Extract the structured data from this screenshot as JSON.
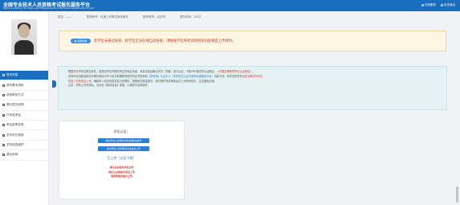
{
  "header": {
    "title": "全国专业技术人员资格考试报名服务平台",
    "subtitle": "Service platform for National Professional and Technical Qualification Exam",
    "links": [
      {
        "icon": "home-icon",
        "label": "在线服务"
      },
      {
        "icon": "user-icon",
        "label": "安全退出"
      }
    ],
    "bg_color": "#1a6ec0"
  },
  "sidebar": {
    "items": [
      {
        "label": "首页导航",
        "active": true,
        "icon": "home-icon"
      },
      {
        "label": "修改基本资料",
        "icon": "edit-icon"
      },
      {
        "label": "修改联系方式",
        "icon": "phone-icon"
      },
      {
        "label": "照片提交说明",
        "icon": "photo-icon"
      },
      {
        "label": "打印准考证",
        "icon": "print-icon"
      },
      {
        "label": "考生报考信息",
        "icon": "info-icon"
      },
      {
        "label": "学历学位核验",
        "icon": "degree-icon"
      },
      {
        "label": "学历信息维护",
        "icon": "database-icon"
      },
      {
        "label": "退出系统",
        "icon": "logout-icon"
      }
    ]
  },
  "infobar": {
    "name": "姓名：——",
    "account": "您的帐号：在读工作单位尚未填写",
    "exam": "报考城市：北京市",
    "date": "发布时间：2022"
  },
  "notice": {
    "badge": "温馨提醒",
    "text": "若学位未通过核查，则学位无法在线自动核查，须根据学位和考试的相关内容规定上传材料。"
  },
  "instructions": {
    "lines": [
      [
        "根据",
        {
          "red": "学历"
        },
        "不符合报名条件，若核查学位时联系所在的地区系统，参见在线经确认学历（学籍）进行认证，下载PDF格式的认证报告，",
        {
          "red": "《中国高等教育学历认证报告》"
        },
        "，"
      ],
      [
        "具体申请流程及操作步骤请参阅中华人民共和国教育部学历证书查询网",
        {
          "blue": "【学信网】认证中心（学历学位认证与查询在线服务平台）"
        },
        "具体方法，有学历的学员",
        {
          "red": "请在高等学历学位"
        }
      ],
      [
        {
          "red": "核查工作完成后上传"
        },
        "，确保本人信息的真实性与完整性，按照相关规定提交，及时按时完成审核后并上传到系统中，注意避免出错。"
      ],
      [
        "注意：材料上传完成后，请点击【保存信息】按钮，以便进行后续操作。"
      ]
    ]
  },
  "school": {
    "label": "学位认证：",
    "btn1": "相关学位认证材料文件在线提交操作",
    "btn2": "提交学位认证材料请点击此处上传",
    "upload_link": "已上传（点击下载）",
    "notes": [
      "请先点击相关学位文件",
      "请在认证报告完成后上传",
      "请按照规定格式上传"
    ]
  }
}
